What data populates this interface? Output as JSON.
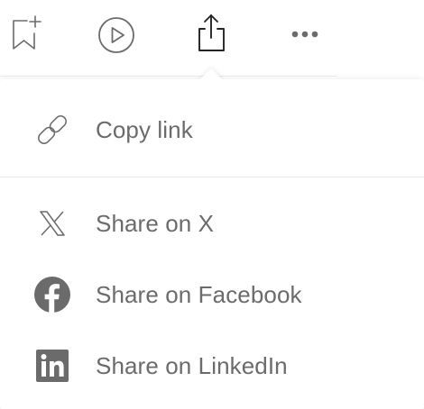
{
  "toolbar": {
    "save_icon": "bookmark-add-icon",
    "listen_icon": "play-circle-icon",
    "share_icon": "share-upload-icon",
    "more_icon": "more-dots-icon"
  },
  "share_menu": {
    "items": [
      {
        "label": "Copy link",
        "icon": "link-icon"
      },
      {
        "label": "Share on X",
        "icon": "x-logo-icon"
      },
      {
        "label": "Share on Facebook",
        "icon": "facebook-icon"
      },
      {
        "label": "Share on LinkedIn",
        "icon": "linkedin-icon"
      }
    ]
  },
  "colors": {
    "icon": "#6b6b6b",
    "text": "#6b6b6b",
    "toolbar_icon": "#242424",
    "divider": "#e6e6e6"
  }
}
